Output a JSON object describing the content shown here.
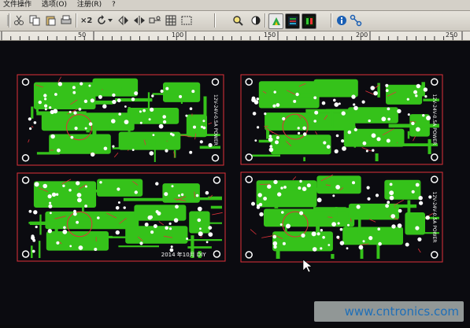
{
  "menu": {
    "items": [
      "文件操作",
      "选项(O)",
      "注册(R)",
      "?"
    ]
  },
  "toolbar": {
    "zoom_label": "×2",
    "buttons": [
      "cut-icon",
      "copy-icon",
      "paste-icon",
      "print-icon",
      "zoom-x2",
      "rotate-icon",
      "dropdown-arrow",
      "flip-h-icon",
      "mirror-icon",
      "component-icon",
      "grid-icon",
      "magnifier-icon",
      "contrast-icon",
      "drc-icon",
      "layers-view-icon",
      "board-view-icon",
      "info-icon",
      "autoroute-icon"
    ]
  },
  "ruler": {
    "ticks": [
      "50",
      "100",
      "150",
      "200",
      "250"
    ]
  },
  "boards": [
    {
      "silk_text": "12V-24V-0.5A POWER"
    },
    {
      "silk_text": "12V-24V-0.5A POWER"
    },
    {
      "silk_text": "2014 年10月 DIY"
    },
    {
      "silk_text": "12V-24V-0.5A POWER"
    }
  ],
  "watermark": {
    "text": "www.cntronics.com"
  },
  "colors": {
    "board_outline": "#e0323a",
    "copper": "#35c21a",
    "pads": "#ffffff",
    "background": "#0b0b10"
  }
}
